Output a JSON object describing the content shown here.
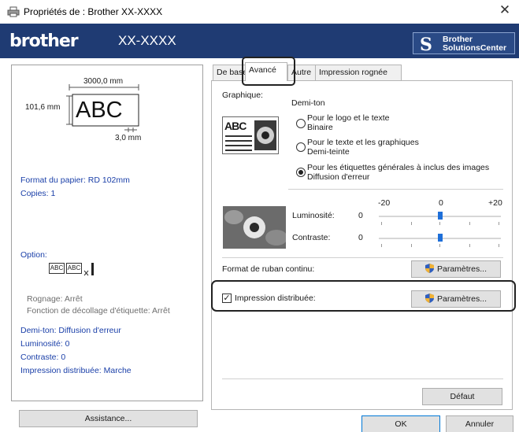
{
  "window": {
    "title": "Propriétés de : Brother XX-XXXX",
    "close": "✕"
  },
  "brand": {
    "logo": "brother",
    "model": "XX-XXXX",
    "solutions_line1": "Brother",
    "solutions_line2": "SolutionsCenter"
  },
  "preview": {
    "width_label": "3000,0 mm",
    "height_label": "101,6 mm",
    "sample_text": "ABC",
    "margin_label": "3,0 mm"
  },
  "left": {
    "paper_format": "Format du papier: RD 102mm",
    "copies": "Copies: 1",
    "option_label": "Option:",
    "option_abc1": "ABC",
    "option_abc2": "ABC",
    "rognage": "Rognage: Arrêt",
    "decollage": "Fonction de décollage d'étiquette: Arrêt",
    "demiton": "Demi-ton: Diffusion d'erreur",
    "luminosite": "Luminosité:  0",
    "contraste": "Contraste:  0",
    "impression": "Impression distribuée: Marche",
    "assistance_button": "Assistance..."
  },
  "tabs": [
    {
      "label": "De base"
    },
    {
      "label": "Avancé"
    },
    {
      "label": "Autre"
    },
    {
      "label": "Impression rognée"
    }
  ],
  "graphique": {
    "label": "Graphique:",
    "demiton_label": "Demi-ton",
    "sample_text": "ABC",
    "options": [
      {
        "line1": "Pour le logo et le texte",
        "line2": "Binaire",
        "selected": false
      },
      {
        "line1": "Pour le texte et les graphiques",
        "line2": "Demi-teinte",
        "selected": false
      },
      {
        "line1": "Pour les étiquettes générales à inclus des images",
        "line2": "Diffusion d'erreur",
        "selected": true
      }
    ]
  },
  "sliders": {
    "scale_min": "-20",
    "scale_mid": "0",
    "scale_max": "+20",
    "luminosite_label": "Luminosité:",
    "luminosite_value": "0",
    "luminosite_level": 0,
    "contraste_label": "Contraste:",
    "contraste_value": "0",
    "contraste_level": 0
  },
  "ruban": {
    "label": "Format de ruban continu:",
    "button": "Paramètres..."
  },
  "distrib": {
    "label": "Impression distribuée:",
    "checked": true,
    "check_mark": "✓",
    "button": "Paramètres..."
  },
  "footer": {
    "defaut": "Défaut",
    "ok": "OK",
    "annuler": "Annuler"
  },
  "colors": {
    "brand_bar": "#1f3b73",
    "blue_text": "#1a3fa8",
    "slider_thumb": "#1e6fd9",
    "shield": "#2f5fbf"
  }
}
